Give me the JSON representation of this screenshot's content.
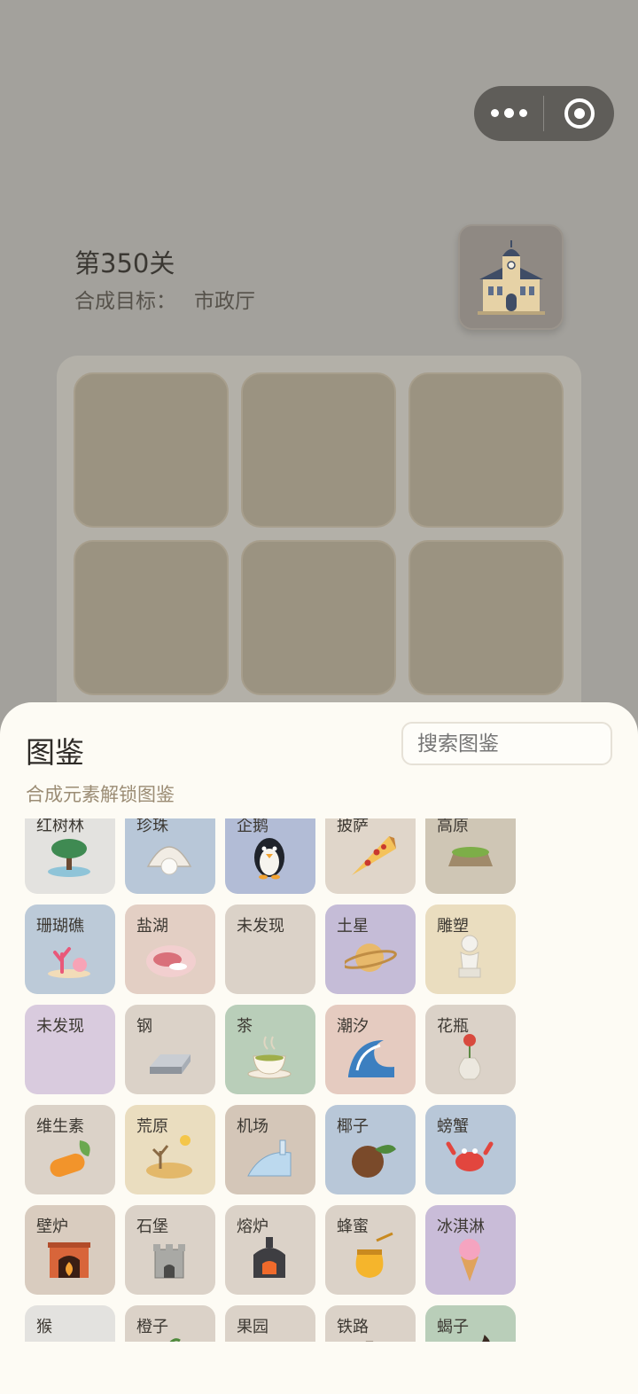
{
  "level": {
    "title": "第350关",
    "goal_label": "合成目标：",
    "goal_value": "市政厅"
  },
  "goal_icon": "city-hall-icon",
  "codex": {
    "title": "图鉴",
    "search_placeholder": "搜索图鉴",
    "subtitle": "合成元素解锁图鉴",
    "rows": [
      [
        {
          "name": "红树林",
          "icon": "mangrove-icon",
          "color": "#e3e2df"
        },
        {
          "name": "珍珠",
          "icon": "pearl-icon",
          "color": "#b8c7d8"
        },
        {
          "name": "企鹅",
          "icon": "penguin-icon",
          "color": "#b2bcd6"
        },
        {
          "name": "披萨",
          "icon": "pizza-icon",
          "color": "#e0d6ca"
        },
        {
          "name": "高原",
          "icon": "plateau-icon",
          "color": "#cfc6b5"
        }
      ],
      [
        {
          "name": "珊瑚礁",
          "icon": "coral-reef-icon",
          "color": "#bccad8"
        },
        {
          "name": "盐湖",
          "icon": "salt-lake-icon",
          "color": "#e3cfc4"
        },
        {
          "name": "未发现",
          "icon": "",
          "color": "#dbd2c8"
        },
        {
          "name": "土星",
          "icon": "saturn-icon",
          "color": "#c5bcd7"
        },
        {
          "name": "雕塑",
          "icon": "sculpture-icon",
          "color": "#eaddbf"
        }
      ],
      [
        {
          "name": "未发现",
          "icon": "",
          "color": "#d9cbde"
        },
        {
          "name": "钢",
          "icon": "steel-icon",
          "color": "#dbd2c8"
        },
        {
          "name": "茶",
          "icon": "tea-icon",
          "color": "#b9ceb9"
        },
        {
          "name": "潮汐",
          "icon": "tide-icon",
          "color": "#e5cbc0"
        },
        {
          "name": "花瓶",
          "icon": "vase-icon",
          "color": "#dbd2c8"
        }
      ],
      [
        {
          "name": "维生素",
          "icon": "vitamin-icon",
          "color": "#dbd2c8"
        },
        {
          "name": "荒原",
          "icon": "wasteland-icon",
          "color": "#eaddbf"
        },
        {
          "name": "机场",
          "icon": "airport-icon",
          "color": "#d4c6b8"
        },
        {
          "name": "椰子",
          "icon": "coconut-icon",
          "color": "#b8c7d8"
        },
        {
          "name": "螃蟹",
          "icon": "crab-icon",
          "color": "#b8c7d8"
        }
      ],
      [
        {
          "name": "壁炉",
          "icon": "fireplace-icon",
          "color": "#d9ccbf"
        },
        {
          "name": "石堡",
          "icon": "stone-castle-icon",
          "color": "#dbd2c8"
        },
        {
          "name": "熔炉",
          "icon": "furnace-icon",
          "color": "#dbd2c8"
        },
        {
          "name": "蜂蜜",
          "icon": "honey-icon",
          "color": "#dbd2c8"
        },
        {
          "name": "冰淇淋",
          "icon": "ice-cream-icon",
          "color": "#c9bcd8"
        }
      ],
      [
        {
          "name": "猴",
          "icon": "monkey-icon",
          "color": "#e3e2df"
        },
        {
          "name": "橙子",
          "icon": "orange-icon",
          "color": "#dbd2c8"
        },
        {
          "name": "果园",
          "icon": "orchard-icon",
          "color": "#dbd2c8"
        },
        {
          "name": "铁路",
          "icon": "railway-icon",
          "color": "#dbd2c8"
        },
        {
          "name": "蝎子",
          "icon": "scorpion-icon",
          "color": "#b9ceb9"
        }
      ]
    ]
  }
}
